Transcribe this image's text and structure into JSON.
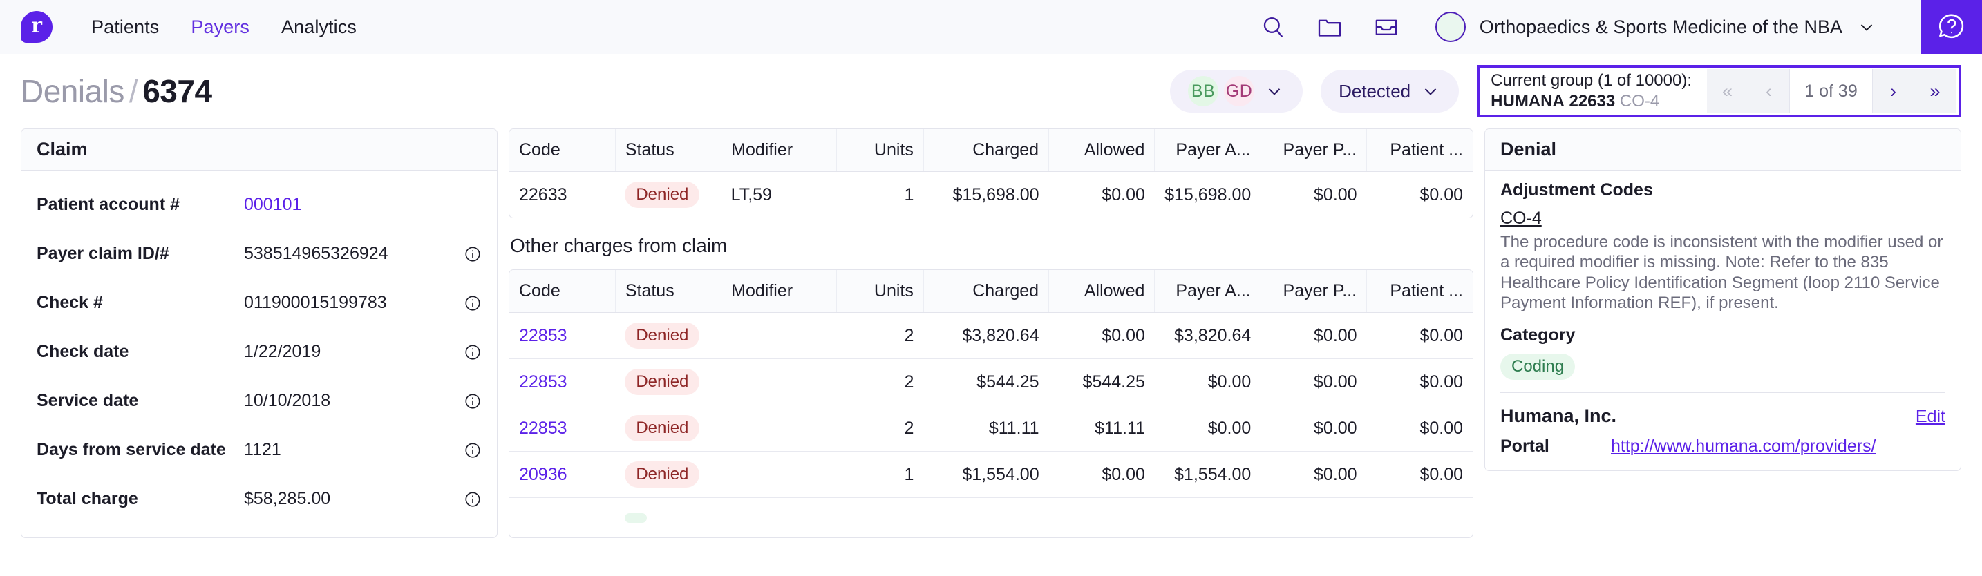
{
  "brand": {
    "logo_letter": "r",
    "accent": "#5b21e8"
  },
  "topnav": {
    "links": [
      {
        "label": "Patients",
        "active": false
      },
      {
        "label": "Payers",
        "active": true
      },
      {
        "label": "Analytics",
        "active": false
      }
    ],
    "icons": [
      "search-icon",
      "folder-icon",
      "inbox-icon"
    ],
    "org_name": "Orthopaedics & Sports Medicine of the NBA",
    "help_label": "?"
  },
  "page": {
    "breadcrumb_parent": "Denials",
    "separator": "/",
    "id": "6374"
  },
  "toolbar": {
    "assignees": [
      {
        "initials": "BB",
        "bg": "#e3f7e6",
        "fg": "#4a9a5e"
      },
      {
        "initials": "GD",
        "bg": "#fbe9f1",
        "fg": "#a33a77"
      }
    ],
    "status_filter": "Detected",
    "group": {
      "line1": "Current group (1 of 10000):",
      "payer": "HUMANA",
      "code": "22633",
      "adjustment": "CO-4"
    },
    "pager": {
      "first": "«",
      "prev": "‹",
      "label": "1 of 39",
      "next": "›",
      "last": "»"
    }
  },
  "claim": {
    "title": "Claim",
    "rows": [
      {
        "key": "Patient account #",
        "value": "000101",
        "link": true,
        "info": false
      },
      {
        "key": "Payer claim ID/#",
        "value": "538514965326924",
        "link": false,
        "info": true
      },
      {
        "key": "Check #",
        "value": "011900015199783",
        "link": false,
        "info": true
      },
      {
        "key": "Check date",
        "value": "1/22/2019",
        "link": false,
        "info": true
      },
      {
        "key": "Service date",
        "value": "10/10/2018",
        "link": false,
        "info": true
      },
      {
        "key": "Days from service date",
        "value": "1121",
        "link": false,
        "info": true
      },
      {
        "key": "Total charge",
        "value": "$58,285.00",
        "link": false,
        "info": true
      }
    ]
  },
  "charges": {
    "columns": [
      "Code",
      "Status",
      "Modifier",
      "Units",
      "Charged",
      "Allowed",
      "Payer A...",
      "Payer P...",
      "Patient ..."
    ],
    "primary_rows": [
      {
        "code": "22633",
        "code_link": false,
        "status": "Denied",
        "status_kind": "denied",
        "modifier": "LT,59",
        "units": "1",
        "charged": "$15,698.00",
        "allowed": "$0.00",
        "payer_adj": "$15,698.00",
        "payer_paid": "$0.00",
        "patient_resp": "$0.00"
      }
    ],
    "other_title": "Other charges from claim",
    "other_rows": [
      {
        "code": "22853",
        "code_link": true,
        "status": "Denied",
        "status_kind": "denied",
        "modifier": "",
        "units": "2",
        "charged": "$3,820.64",
        "allowed": "$0.00",
        "payer_adj": "$3,820.64",
        "payer_paid": "$0.00",
        "patient_resp": "$0.00"
      },
      {
        "code": "22853",
        "code_link": true,
        "status": "Denied",
        "status_kind": "denied",
        "modifier": "",
        "units": "2",
        "charged": "$544.25",
        "allowed": "$544.25",
        "payer_adj": "$0.00",
        "payer_paid": "$0.00",
        "patient_resp": "$0.00"
      },
      {
        "code": "22853",
        "code_link": true,
        "status": "Denied",
        "status_kind": "denied",
        "modifier": "",
        "units": "2",
        "charged": "$11.11",
        "allowed": "$11.11",
        "payer_adj": "$0.00",
        "payer_paid": "$0.00",
        "patient_resp": "$0.00"
      },
      {
        "code": "20936",
        "code_link": true,
        "status": "Denied",
        "status_kind": "denied",
        "modifier": "",
        "units": "1",
        "charged": "$1,554.00",
        "allowed": "$0.00",
        "payer_adj": "$1,554.00",
        "payer_paid": "$0.00",
        "patient_resp": "$0.00"
      },
      {
        "code": "",
        "code_link": true,
        "status": "",
        "status_kind": "paid",
        "modifier": "",
        "units": "",
        "charged": "",
        "allowed": "",
        "payer_adj": "",
        "payer_paid": "",
        "patient_resp": ""
      }
    ]
  },
  "denial": {
    "title": "Denial",
    "adjustment_label": "Adjustment Codes",
    "adjustment_code": "CO-4",
    "adjustment_description": "The procedure code is inconsistent with the modifier used or a required modifier is missing. Note: Refer to the 835 Healthcare Policy Identification Segment (loop 2110 Service Payment Information REF), if present.",
    "category_label": "Category",
    "category_value": "Coding",
    "payer_name": "Humana, Inc.",
    "edit_label": "Edit",
    "portal_label": "Portal",
    "portal_url": "http://www.humana.com/providers/"
  }
}
